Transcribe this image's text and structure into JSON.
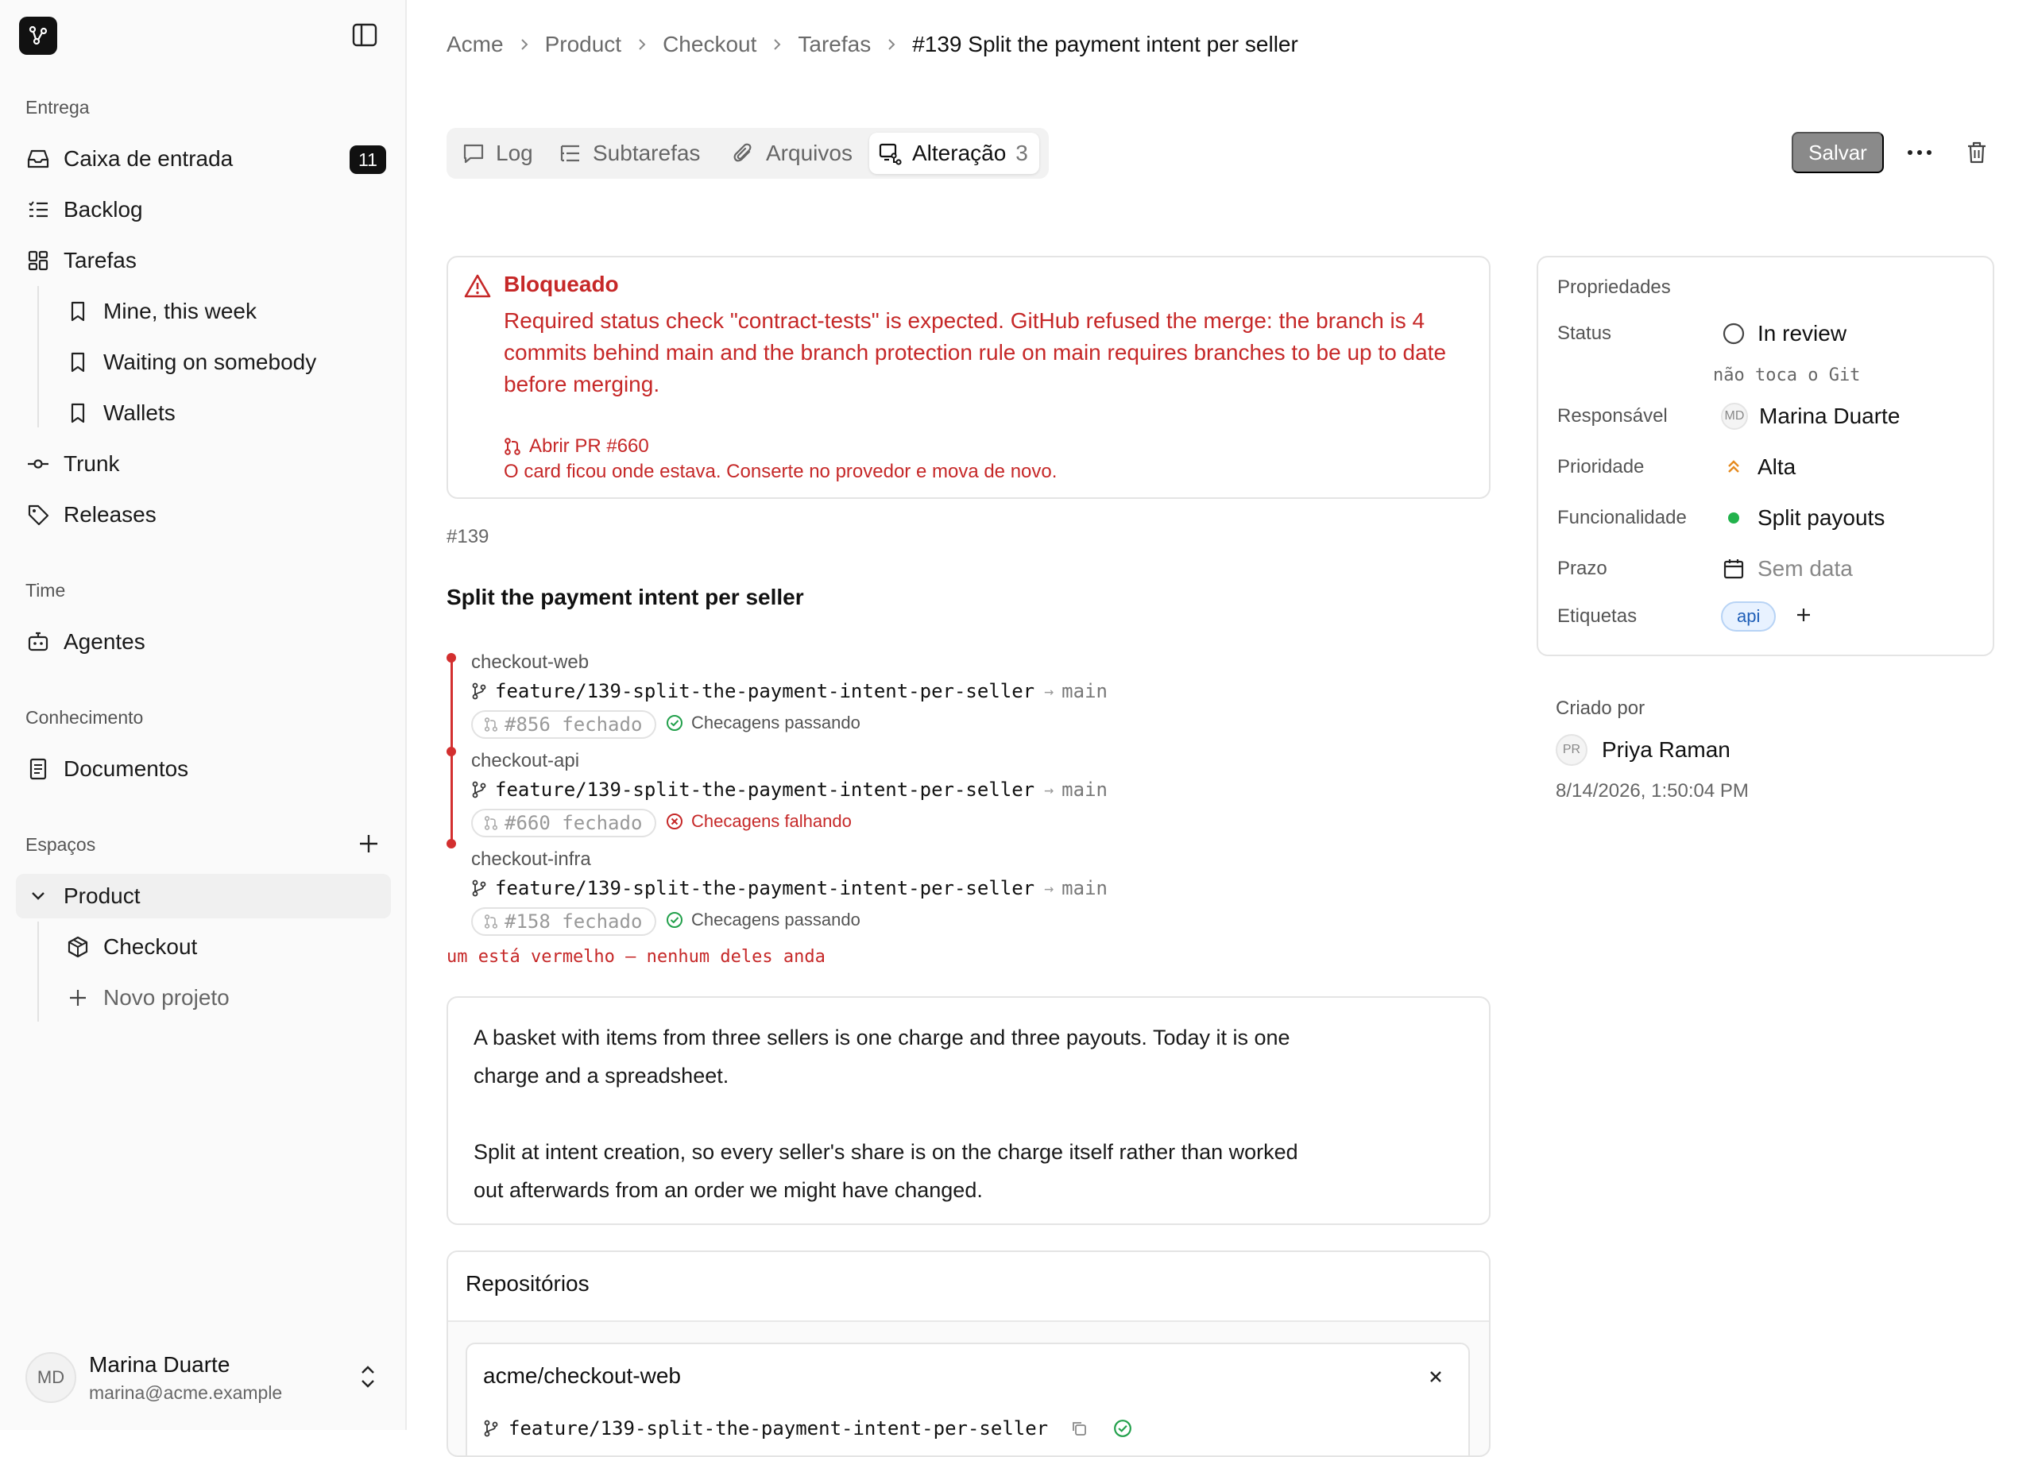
{
  "sidebar": {
    "sections": {
      "entrega": "Entrega",
      "time": "Time",
      "conhecimento": "Conhecimento",
      "espacos": "Espaços"
    },
    "items": {
      "inbox": {
        "label": "Caixa de entrada",
        "badge": "11",
        "icon": "inbox-icon"
      },
      "backlog": {
        "label": "Backlog",
        "icon": "list-icon"
      },
      "tarefas": {
        "label": "Tarefas",
        "icon": "grid-icon"
      },
      "mine": {
        "label": "Mine, this week",
        "icon": "bookmark-icon"
      },
      "waiting": {
        "label": "Waiting on somebody",
        "icon": "bookmark-icon"
      },
      "wallets": {
        "label": "Wallets",
        "icon": "bookmark-icon"
      },
      "trunk": {
        "label": "Trunk",
        "icon": "commit-icon"
      },
      "releases": {
        "label": "Releases",
        "icon": "tag-icon"
      },
      "agentes": {
        "label": "Agentes",
        "icon": "bot-icon"
      },
      "documentos": {
        "label": "Documentos",
        "icon": "document-icon"
      },
      "product": {
        "label": "Product",
        "icon": "chevron-down-icon"
      },
      "checkout": {
        "label": "Checkout",
        "icon": "box-icon"
      },
      "novo_projeto": {
        "label": "Novo projeto",
        "icon": "plus-icon"
      }
    },
    "user": {
      "initials": "MD",
      "name": "Marina Duarte",
      "email": "marina@acme.example"
    }
  },
  "breadcrumb": [
    "Acme",
    "Product",
    "Checkout",
    "Tarefas",
    "#139 Split the payment intent per seller"
  ],
  "tabs": [
    {
      "label": "Log",
      "icon": "comment-icon"
    },
    {
      "label": "Subtarefas",
      "icon": "subtasks-icon"
    },
    {
      "label": "Arquivos",
      "icon": "paperclip-icon"
    },
    {
      "label": "Alteração",
      "count": "3",
      "icon": "git-change-icon",
      "active": true
    }
  ],
  "toolbar": {
    "save_label": "Salvar"
  },
  "blocked": {
    "title": "Bloqueado",
    "message": "Required status check \"contract-tests\" is expected. GitHub refused the merge: the branch is 4 commits behind main and the branch protection rule on main requires branches to be up to date before merging.",
    "pr_link": "Abrir PR #660",
    "hint": "O card ficou onde estava. Conserte no provedor e mova de novo."
  },
  "issue": {
    "number": "#139",
    "title": "Split the payment intent per seller"
  },
  "changes": [
    {
      "repo": "checkout-web",
      "branch": "feature/139-split-the-payment-intent-per-seller",
      "arrow": "→",
      "target": "main",
      "pr": "#856 fechado",
      "checks": "Checagens passando",
      "status": "pass"
    },
    {
      "repo": "checkout-api",
      "branch": "feature/139-split-the-payment-intent-per-seller",
      "arrow": "→",
      "target": "main",
      "pr": "#660 fechado",
      "checks": "Checagens falhando",
      "status": "fail"
    },
    {
      "repo": "checkout-infra",
      "branch": "feature/139-split-the-payment-intent-per-seller",
      "arrow": "→",
      "target": "main",
      "pr": "#158 fechado",
      "checks": "Checagens passando",
      "status": "pass"
    }
  ],
  "changes_note": "um está vermelho — nenhum deles anda",
  "description": [
    "A basket with items from three sellers is one charge and three payouts. Today it is one charge and a spreadsheet.",
    "Split at intent creation, so every seller's share is on the charge itself rather than worked out afterwards from an order we might have changed."
  ],
  "repositories": {
    "title": "Repositórios",
    "items": [
      {
        "name": "acme/checkout-web",
        "branch": "feature/139-split-the-payment-intent-per-seller"
      }
    ]
  },
  "properties": {
    "title": "Propriedades",
    "status": {
      "label": "Status",
      "value": "In review",
      "note": "não toca o Git"
    },
    "assignee": {
      "label": "Responsável",
      "initials": "MD",
      "value": "Marina Duarte"
    },
    "priority": {
      "label": "Prioridade",
      "value": "Alta"
    },
    "feature": {
      "label": "Funcionalidade",
      "value": "Split payouts"
    },
    "due": {
      "label": "Prazo",
      "value": "Sem data"
    },
    "labels": {
      "label": "Etiquetas",
      "value": "api"
    }
  },
  "created": {
    "label": "Criado por",
    "initials": "PR",
    "name": "Priya Raman",
    "date": "8/14/2026, 1:50:04 PM"
  },
  "colors": {
    "danger": "#c62828",
    "success": "#22a04b",
    "accent_priority": "#e58a1f",
    "tag_blue": "#1f5fb8",
    "feature_dot": "#22b24c"
  }
}
